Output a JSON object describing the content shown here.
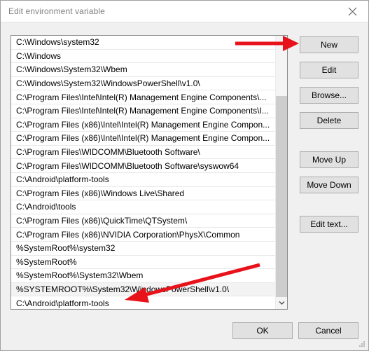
{
  "window": {
    "title": "Edit environment variable",
    "close_icon": "close-icon"
  },
  "list": {
    "selected_index": 18,
    "items": [
      "C:\\Windows\\system32",
      "C:\\Windows",
      "C:\\Windows\\System32\\Wbem",
      "C:\\Windows\\System32\\WindowsPowerShell\\v1.0\\",
      "C:\\Program Files\\Intel\\Intel(R) Management Engine Components\\...",
      "C:\\Program Files\\Intel\\Intel(R) Management Engine Components\\I...",
      "C:\\Program Files (x86)\\Intel\\Intel(R) Management Engine Compon...",
      "C:\\Program Files (x86)\\Intel\\Intel(R) Management Engine Compon...",
      "C:\\Program Files\\WIDCOMM\\Bluetooth Software\\",
      "C:\\Program Files\\WIDCOMM\\Bluetooth Software\\syswow64",
      "C:\\Android\\platform-tools",
      "C:\\Program Files (x86)\\Windows Live\\Shared",
      "C:\\Android\\tools",
      "C:\\Program Files (x86)\\QuickTime\\QTSystem\\",
      "C:\\Program Files (x86)\\NVIDIA Corporation\\PhysX\\Common",
      "%SystemRoot%\\system32",
      "%SystemRoot%",
      "%SystemRoot%\\System32\\Wbem",
      "%SYSTEMROOT%\\System32\\WindowsPowerShell\\v1.0\\",
      "C:\\Android\\platform-tools"
    ]
  },
  "scrollbar": {
    "down_icon": "chevron-down-icon"
  },
  "side_buttons": [
    {
      "id": "new",
      "label": "New"
    },
    {
      "id": "edit",
      "label": "Edit"
    },
    {
      "id": "browse",
      "label": "Browse..."
    },
    {
      "id": "delete",
      "label": "Delete"
    },
    {
      "id": "move-up",
      "label": "Move Up"
    },
    {
      "id": "move-down",
      "label": "Move Down"
    },
    {
      "id": "edit-text",
      "label": "Edit text..."
    }
  ],
  "bottom_buttons": {
    "ok": "OK",
    "cancel": "Cancel"
  },
  "annotations": {
    "color": "#e8131a",
    "arrow_top": "arrow-pointing-right-to-new-button",
    "arrow_bottom": "arrow-pointing-to-last-list-row"
  }
}
